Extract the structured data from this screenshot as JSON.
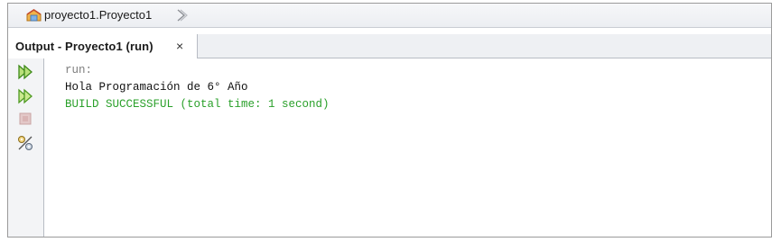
{
  "breadcrumb": {
    "icon": "project-package-icon",
    "path": "proyecto1.Proyecto1"
  },
  "tab": {
    "title": "Output - Proyecto1 (run)",
    "close_glyph": "×"
  },
  "toolbar": {
    "items": [
      "rerun-icon",
      "rerun-with-options-icon",
      "stop-icon",
      "settings-icon"
    ]
  },
  "output": {
    "lines": [
      {
        "text": "run:",
        "color": "#7f7f7f"
      },
      {
        "text": "Hola Programación de 6° Año",
        "color": "#111111"
      },
      {
        "text": "BUILD SUCCESSFUL (total time: 1 second)",
        "color": "#2aa02a"
      }
    ]
  }
}
